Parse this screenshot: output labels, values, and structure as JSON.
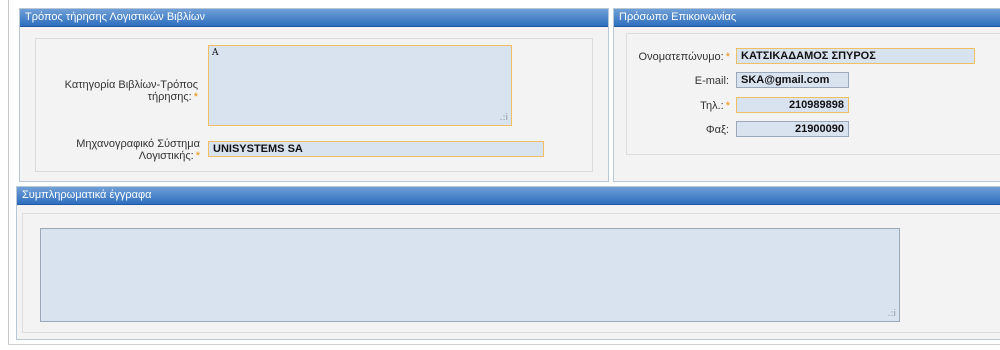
{
  "books": {
    "header": "Τρόπος τήρησης Λογιστικών Βιβλίων",
    "category_label": "Κατηγορία Βιβλίων-Τρόπος τήρησης:",
    "category_value": "A",
    "software_label": "Μηχανογραφικό Σύστημα Λογιστικής:",
    "software_value": "UNISYSTEMS SA"
  },
  "contact": {
    "header": "Πρόσωπο Επικοινωνίας",
    "name_label": "Ονοματεπώνυμο:",
    "name_value": "ΚΑΤΣΙΚΑΔΑΜΟΣ ΣΠΥΡΟΣ",
    "email_label": "E-mail:",
    "email_value": "SKA@gmail.com",
    "phone_label": "Τηλ.:",
    "phone_value": "210989898",
    "fax_label": "Φαξ:",
    "fax_value": "21900090"
  },
  "documents": {
    "header": "Συμπληρωματικά έγγραφα",
    "value": ""
  },
  "required_mark": "*",
  "resize_grip": ".:i",
  "colors": {
    "header_top": "#6f9fd6",
    "header_bottom": "#2f6fbf",
    "field_bg": "#d9e2ef",
    "required": "#f08c00"
  }
}
